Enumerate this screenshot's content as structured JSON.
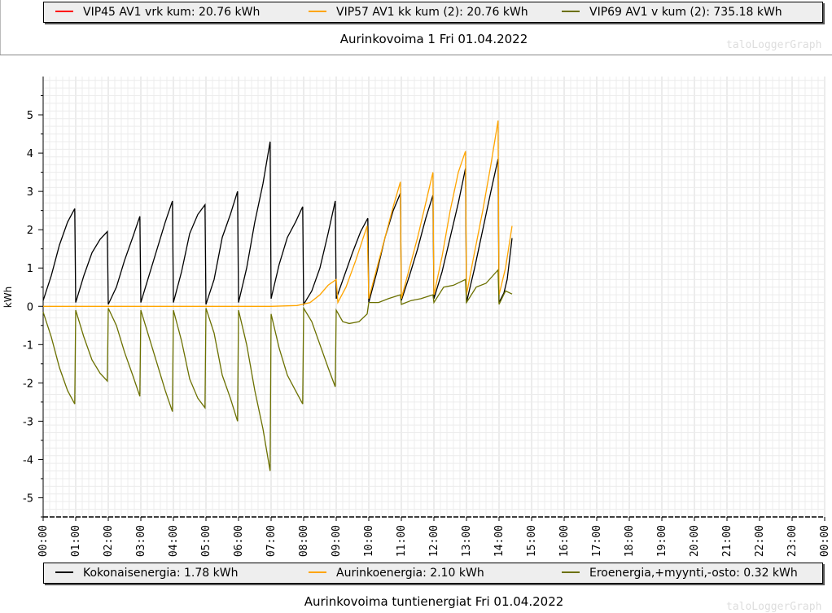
{
  "top_legend": [
    {
      "label": "VIP45 AV1 vrk kum: 20.76 kWh",
      "color": "#ff0000"
    },
    {
      "label": "VIP57 AV1 kk kum (2): 20.76 kWh",
      "color": "#ffa500"
    },
    {
      "label": "VIP69 AV1 v kum (2): 735.18 kWh",
      "color": "#6b7000"
    }
  ],
  "top_title": "Aurinkovoima 1 Fri 01.04.2022",
  "watermark": "taloLoggerGraph",
  "bottom_legend": [
    {
      "label": "Kokonaisenergia: 1.78 kWh",
      "color": "#000000"
    },
    {
      "label": "Aurinkoenergia: 2.10 kWh",
      "color": "#ffa500"
    },
    {
      "label": "Eroenergia,+myynti,-osto: 0.32 kWh",
      "color": "#6b7000"
    }
  ],
  "bottom_title": "Aurinkovoima tuntienergiat Fri 01.04.2022",
  "chart_data": {
    "type": "line",
    "title": "",
    "xlabel": "",
    "ylabel": "kWh",
    "xlim": [
      0,
      24
    ],
    "ylim": [
      -5.5,
      6
    ],
    "grid": true,
    "x_tick_labels": [
      "00:00",
      "01:00",
      "02:00",
      "03:00",
      "04:00",
      "05:00",
      "06:00",
      "07:00",
      "08:00",
      "09:00",
      "10:00",
      "11:00",
      "12:00",
      "13:00",
      "14:00",
      "15:00",
      "16:00",
      "17:00",
      "18:00",
      "19:00",
      "20:00",
      "21:00",
      "22:00",
      "23:00",
      "00:00"
    ],
    "y_tick_labels": [
      "5",
      "4",
      "3",
      "2",
      "1",
      "0",
      "-1",
      "-2",
      "-3",
      "-4",
      "-5"
    ],
    "y_tick_values": [
      5,
      4,
      3,
      2,
      1,
      0,
      -1,
      -2,
      -3,
      -4,
      -5
    ],
    "series": [
      {
        "name": "Kokonaisenergia",
        "color": "#000000",
        "x": [
          0,
          0.25,
          0.5,
          0.75,
          0.97,
          1.0,
          1.25,
          1.5,
          1.75,
          1.97,
          2.0,
          2.25,
          2.5,
          2.75,
          2.97,
          3.0,
          3.25,
          3.5,
          3.75,
          3.97,
          4.0,
          4.25,
          4.5,
          4.75,
          4.97,
          5.0,
          5.25,
          5.5,
          5.75,
          5.97,
          6.0,
          6.25,
          6.5,
          6.75,
          6.97,
          7.0,
          7.25,
          7.5,
          7.75,
          7.97,
          8.0,
          8.25,
          8.5,
          8.75,
          8.97,
          9.0,
          9.25,
          9.5,
          9.75,
          9.97,
          10.0,
          10.25,
          10.5,
          10.75,
          10.97,
          11.0,
          11.25,
          11.5,
          11.75,
          11.97,
          12.0,
          12.25,
          12.5,
          12.75,
          12.97,
          13.0,
          13.25,
          13.5,
          13.75,
          13.97,
          14.0,
          14.15,
          14.25,
          14.4
        ],
        "y": [
          0.15,
          0.8,
          1.6,
          2.2,
          2.55,
          0.1,
          0.8,
          1.4,
          1.75,
          1.95,
          0.05,
          0.5,
          1.2,
          1.8,
          2.35,
          0.1,
          0.8,
          1.5,
          2.2,
          2.75,
          0.1,
          0.9,
          1.9,
          2.4,
          2.65,
          0.05,
          0.7,
          1.8,
          2.4,
          3.0,
          0.1,
          1.0,
          2.2,
          3.2,
          4.3,
          0.2,
          1.1,
          1.8,
          2.2,
          2.6,
          0.05,
          0.4,
          1.0,
          1.9,
          2.75,
          0.2,
          0.8,
          1.4,
          1.95,
          2.3,
          0.1,
          0.9,
          1.8,
          2.5,
          2.95,
          0.15,
          0.8,
          1.5,
          2.3,
          2.9,
          0.2,
          0.9,
          1.8,
          2.7,
          3.6,
          0.1,
          1.0,
          2.0,
          3.0,
          3.85,
          0.1,
          0.35,
          0.7,
          1.78
        ]
      },
      {
        "name": "Aurinkoenergia",
        "color": "#ffa500",
        "x": [
          0,
          7.0,
          7.8,
          8.2,
          8.5,
          8.75,
          9.0,
          9.05,
          9.3,
          9.6,
          9.95,
          10.0,
          10.25,
          10.5,
          10.75,
          10.97,
          11.0,
          11.25,
          11.5,
          11.75,
          11.97,
          12.0,
          12.25,
          12.5,
          12.75,
          12.97,
          13.0,
          13.2,
          13.5,
          13.75,
          13.97,
          14.0,
          14.2,
          14.4
        ],
        "y": [
          0,
          0,
          0.02,
          0.1,
          0.3,
          0.55,
          0.7,
          0.1,
          0.5,
          1.2,
          2.1,
          0.2,
          1.0,
          1.8,
          2.6,
          3.25,
          0.2,
          1.0,
          1.8,
          2.7,
          3.5,
          0.3,
          1.3,
          2.5,
          3.5,
          4.05,
          0.3,
          1.2,
          2.5,
          3.7,
          4.85,
          0.3,
          1.0,
          2.1
        ]
      },
      {
        "name": "Eroenergia,+myynti,-osto",
        "color": "#6b7000",
        "x": [
          0,
          0.25,
          0.5,
          0.75,
          0.97,
          1.0,
          1.25,
          1.5,
          1.75,
          1.97,
          2.0,
          2.25,
          2.5,
          2.75,
          2.97,
          3.0,
          3.25,
          3.5,
          3.75,
          3.97,
          4.0,
          4.25,
          4.5,
          4.75,
          4.97,
          5.0,
          5.25,
          5.5,
          5.75,
          5.97,
          6.0,
          6.25,
          6.5,
          6.75,
          6.97,
          7.0,
          7.25,
          7.5,
          7.75,
          7.97,
          8.0,
          8.25,
          8.5,
          8.75,
          8.97,
          9.0,
          9.2,
          9.4,
          9.7,
          9.95,
          10.0,
          10.3,
          10.6,
          10.97,
          11.0,
          11.3,
          11.6,
          11.97,
          12.0,
          12.3,
          12.6,
          12.97,
          13.0,
          13.3,
          13.6,
          13.97,
          14.0,
          14.2,
          14.4
        ],
        "y": [
          -0.15,
          -0.8,
          -1.6,
          -2.2,
          -2.55,
          -0.1,
          -0.8,
          -1.4,
          -1.75,
          -1.95,
          -0.05,
          -0.5,
          -1.2,
          -1.8,
          -2.35,
          -0.1,
          -0.8,
          -1.5,
          -2.2,
          -2.75,
          -0.1,
          -0.9,
          -1.9,
          -2.4,
          -2.65,
          -0.05,
          -0.7,
          -1.8,
          -2.4,
          -3.0,
          -0.1,
          -1.0,
          -2.2,
          -3.2,
          -4.3,
          -0.2,
          -1.1,
          -1.8,
          -2.2,
          -2.55,
          -0.05,
          -0.4,
          -1.0,
          -1.6,
          -2.1,
          -0.1,
          -0.4,
          -0.45,
          -0.4,
          -0.2,
          0.1,
          0.1,
          0.2,
          0.3,
          0.05,
          0.15,
          0.2,
          0.3,
          0.1,
          0.5,
          0.55,
          0.7,
          0.1,
          0.5,
          0.6,
          0.95,
          0.05,
          0.4,
          0.32
        ]
      }
    ]
  }
}
